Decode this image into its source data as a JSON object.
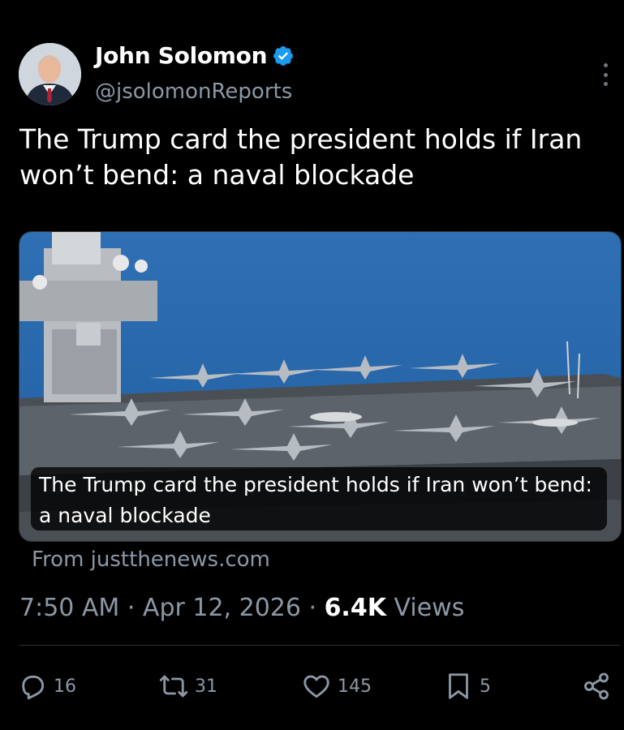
{
  "author": {
    "name": "John Solomon",
    "handle": "@jsolomonReports",
    "verified_color": "#1d9bf0"
  },
  "tweet": {
    "text": "The Trump card the president holds if Iran won’t bend: a naval blockade"
  },
  "card": {
    "headline": "The Trump card the president holds if Iran won’t bend: a naval blockade",
    "source": "From justthenews.com",
    "image_subject": "aircraft carrier deck with fighter jets at sea"
  },
  "meta": {
    "time": "7:50 AM",
    "sep1": " · ",
    "date": "Apr 12, 2026",
    "sep2": " · ",
    "views_count": "6.4K",
    "views_label": " Views"
  },
  "actions": {
    "replies": "16",
    "reposts": "31",
    "likes": "145",
    "bookmarks": "5"
  },
  "icons": [
    "verified-badge-icon",
    "more-options-icon",
    "reply-icon",
    "repost-icon",
    "like-icon",
    "bookmark-icon",
    "share-icon"
  ]
}
